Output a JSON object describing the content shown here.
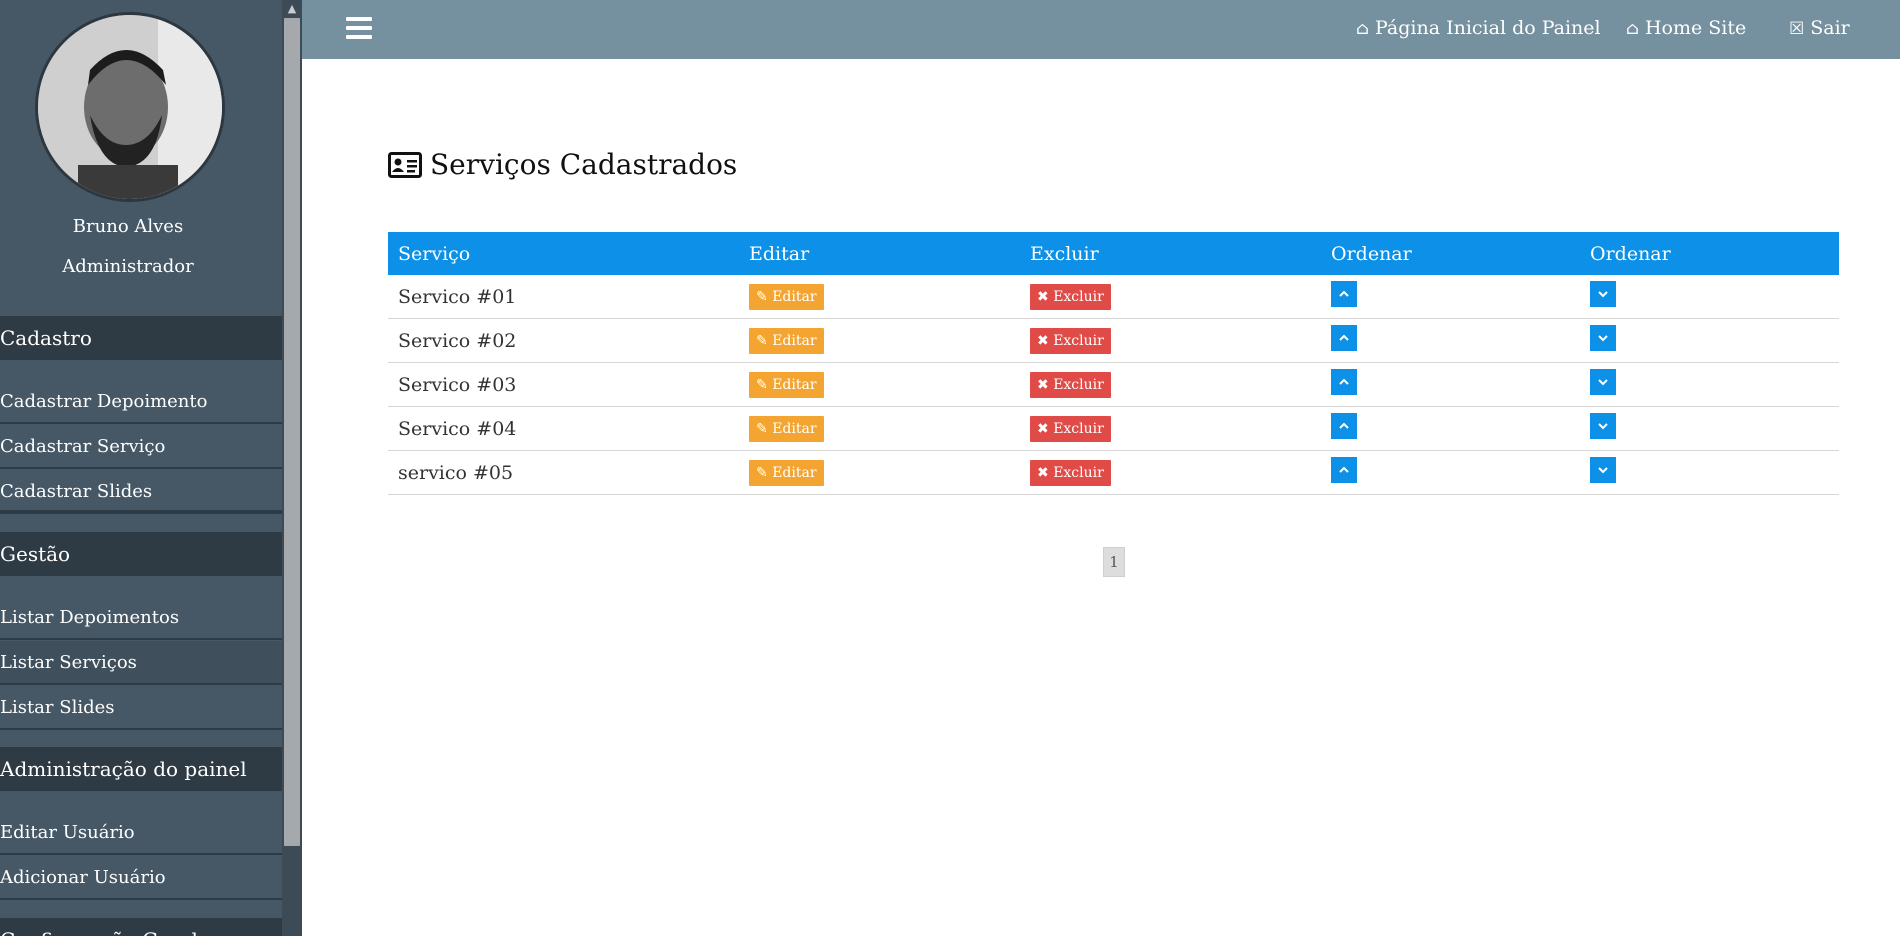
{
  "sidebar": {
    "user_name": "Bruno Alves",
    "user_role": "Administrador",
    "sections": [
      {
        "title": "Cadastro",
        "items": [
          "Cadastrar Depoimento",
          "Cadastrar Serviço",
          "Cadastrar Slides"
        ]
      },
      {
        "title": "Gestão",
        "items": [
          "Listar Depoimentos",
          "Listar Serviços",
          "Listar Slides"
        ]
      },
      {
        "title": "Administração do painel",
        "items": [
          "Editar Usuário",
          "Adicionar Usuário"
        ]
      },
      {
        "title": "Configuração Geral"
      }
    ]
  },
  "topbar": {
    "links": [
      "Página Inicial do Painel",
      "Home Site",
      "Sair"
    ]
  },
  "main": {
    "title": "Serviços Cadastrados",
    "table": {
      "headers": [
        "Serviço",
        "Editar",
        "Excluir",
        "Ordenar",
        "Ordenar"
      ],
      "rows": [
        "Servico #01",
        "Servico #02",
        "Servico #03",
        "Servico #04",
        "servico #05"
      ],
      "edit_label": "Editar",
      "delete_label": "Excluir"
    },
    "pagination": "1"
  },
  "colors": {
    "sidebar_bg": "#465866",
    "section_bg": "#2f3b44",
    "topbar_bg": "#75909e",
    "table_header": "#0d91e8",
    "edit_button": "#f4a531",
    "delete_button": "#e04b47"
  },
  "icons": [
    "menu-icon",
    "home-icon",
    "close-box-icon",
    "id-card-icon",
    "pencil-icon",
    "x-icon",
    "chevron-up-icon",
    "chevron-down-icon"
  ]
}
